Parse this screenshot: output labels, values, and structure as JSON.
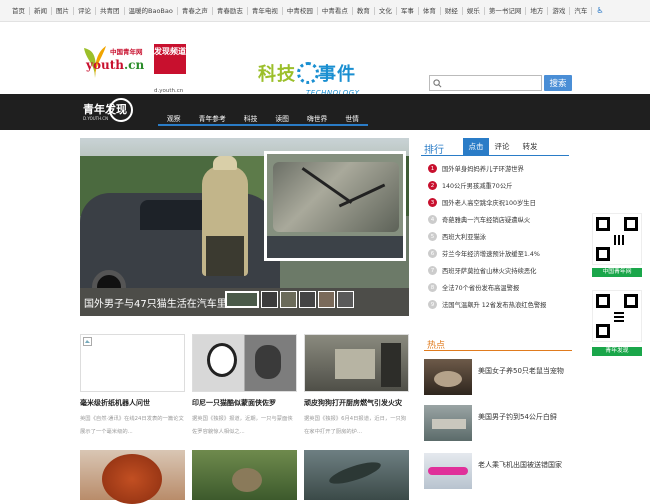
{
  "topnav": {
    "items": [
      "首页",
      "新闻",
      "图片",
      "评论",
      "共青团",
      "温暖的BaoBao",
      "青春之声",
      "青春励志",
      "青年电视",
      "中青校园",
      "中青看点",
      "教育",
      "文化",
      "军事",
      "体育",
      "财经",
      "娱乐",
      "第一书记网",
      "地方",
      "游戏",
      "汽车"
    ],
    "accessibility_icon": "wheelchair-icon"
  },
  "logo": {
    "brand": "中国青年网",
    "youth_a": "youth",
    "youth_b": ".cn",
    "tag": "发现频道",
    "url": "d.youth.cn"
  },
  "section_logo": {
    "cn_a": "科技",
    "cn_b": "事件",
    "en": "TECHNOLOGY"
  },
  "search": {
    "placeholder": "",
    "button": "搜索"
  },
  "bar": {
    "mark": "青年发现",
    "mark_sub": "D.YOUTH.CN",
    "menu": [
      "观察",
      "青年参考",
      "科技",
      "读图",
      "嗨世界",
      "世情"
    ]
  },
  "hero": {
    "caption": "国外男子与47只猫生活在汽车里",
    "thumbs": 6,
    "selected_thumb": 0
  },
  "rank": {
    "title": "排行",
    "tabs": [
      "点击",
      "评论",
      "转发"
    ],
    "active_tab": 0,
    "items": [
      "国外单身妈妈养儿子环游世界",
      "140公斤男孩减重70公斤",
      "国外老人高空跳伞庆祝100岁生日",
      "奇葩雅典一汽车经销店疑遭纵火",
      "西班大利亚猫泳",
      "芬兰今年经济增速预计放缓至1.4%",
      "西班牙萨莫拉省山林火灾持续恶化",
      "全法70个省份发布高温警报",
      "法国气温飙升 12省发布热浪红色警报"
    ]
  },
  "cards": [
    {
      "title": "毫米级折纸机器人问世",
      "desc": "英国《自然·通讯》在线24日发表的一篇论文展示了一个毫米级的..."
    },
    {
      "title": "印尼一只猫酷似蒙面侠佐罗",
      "desc": "据英国《独报》报道，近期，一只与蒙面侠佐罗容貌惊人相似之..."
    },
    {
      "title": "顽皮狗狗打开厨房燃气引发火灾",
      "desc": "据英国《独报》6月4日报道，近日，一只狗在家中打开了厨房的炉..."
    }
  ],
  "hot": {
    "title": "热点",
    "items": [
      "美国女子养50只老鼠当宠物",
      "美国男子钓到54公斤白鲟",
      "老人乘飞机出国被送错国家"
    ]
  },
  "qr": {
    "label1": "中国青年网",
    "label2": "青年发现"
  }
}
